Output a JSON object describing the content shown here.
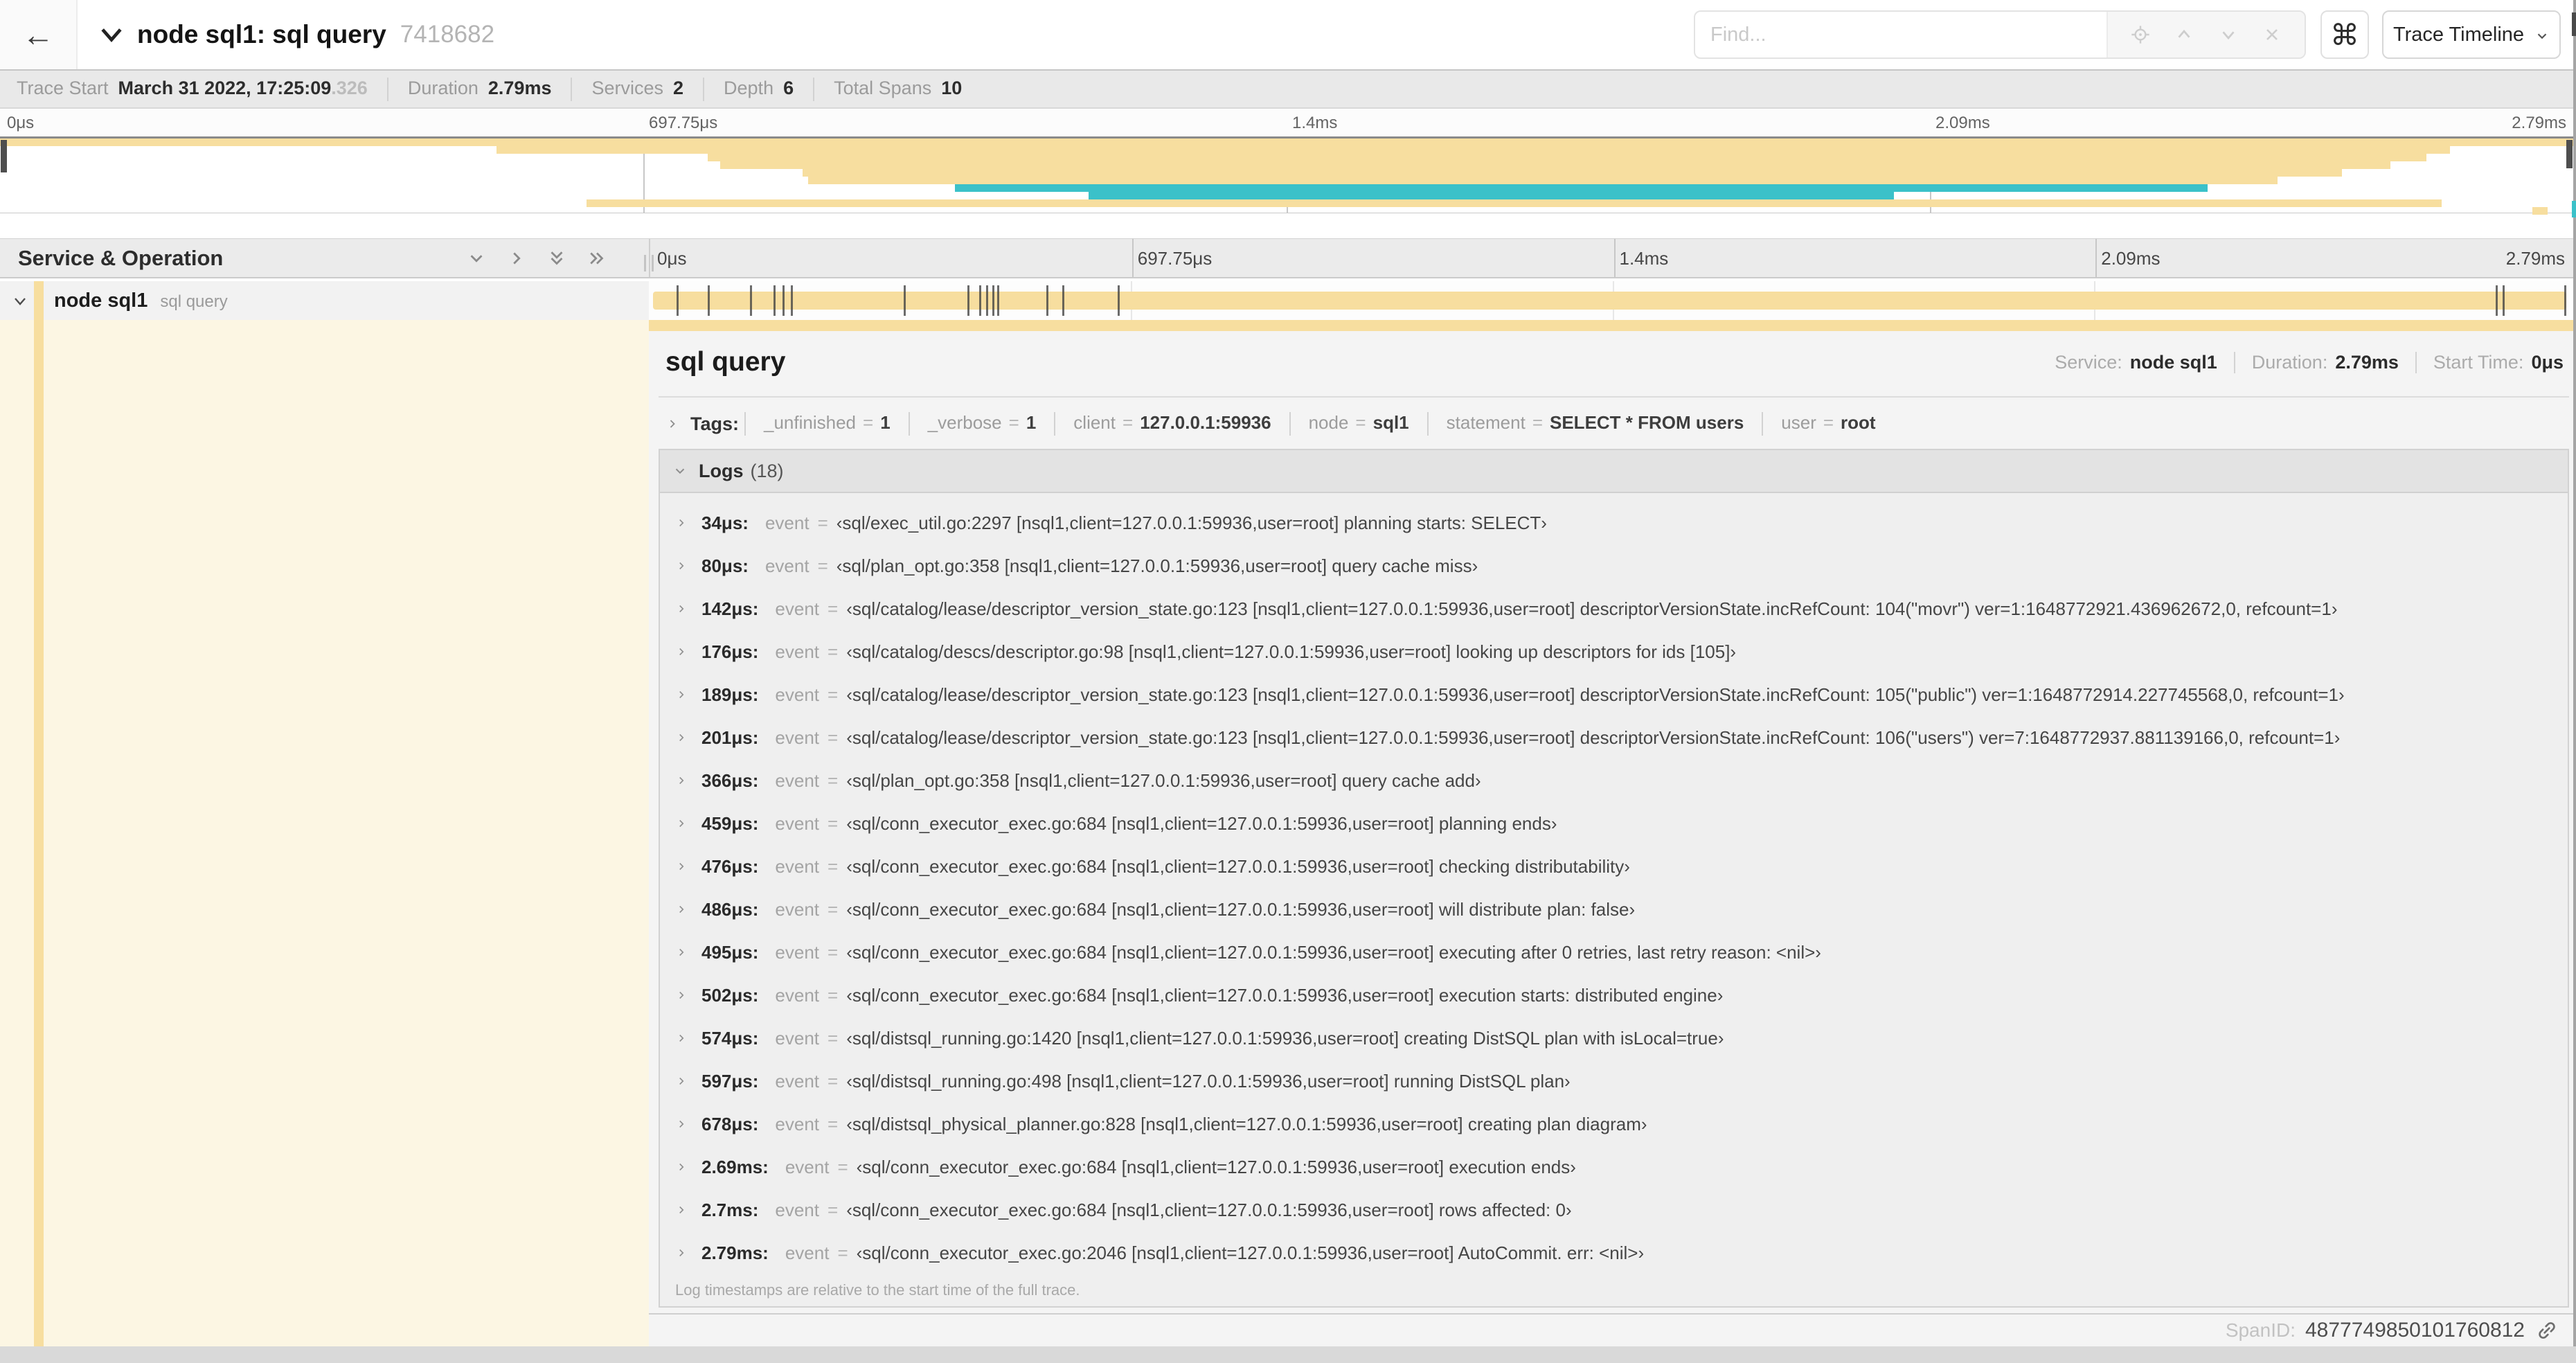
{
  "colors": {
    "tan": "#F7DE9F",
    "teal": "#3BC1C9"
  },
  "trace": {
    "duration_us": 2790
  },
  "header": {
    "back_icon": "←",
    "title": "node sql1: sql query",
    "trace_id": "7418682",
    "find_placeholder": "Find...",
    "shortcuts_glyph": "⌘",
    "view_selector": "Trace Timeline"
  },
  "summary": {
    "items": [
      {
        "label": "Trace Start",
        "value": "March 31 2022, 17:25:09",
        "suffix": ".326"
      },
      {
        "label": "Duration",
        "value": "2.79ms"
      },
      {
        "label": "Services",
        "value": "2"
      },
      {
        "label": "Depth",
        "value": "6"
      },
      {
        "label": "Total Spans",
        "value": "10"
      }
    ]
  },
  "timeline": {
    "ticks": [
      "0μs",
      "697.75μs",
      "1.4ms",
      "2.09ms",
      "2.79ms"
    ]
  },
  "minimap": {
    "spans": [
      {
        "start": 0,
        "end": 100,
        "color": "tan"
      },
      {
        "start": 19.3,
        "end": 95.2,
        "color": "tan"
      },
      {
        "start": 27.5,
        "end": 94.3,
        "color": "tan"
      },
      {
        "start": 28.0,
        "end": 92.9,
        "color": "tan"
      },
      {
        "start": 31.2,
        "end": 91.0,
        "color": "tan"
      },
      {
        "start": 31.4,
        "end": 88.5,
        "color": "tan"
      },
      {
        "start": 37.1,
        "end": 85.8,
        "color": "teal"
      },
      {
        "start": 42.3,
        "end": 73.6,
        "color": "teal"
      },
      {
        "start": 22.8,
        "end": 94.9,
        "color": "tan"
      },
      {
        "start": 98.4,
        "end": 99.0,
        "color": "tan"
      }
    ]
  },
  "tree": {
    "header": "Service & Operation",
    "service": "node sql1",
    "operation": "sql query"
  },
  "detail": {
    "title": "sql query",
    "meta": [
      {
        "label": "Service:",
        "value": "node sql1"
      },
      {
        "label": "Duration:",
        "value": "2.79ms"
      },
      {
        "label": "Start Time:",
        "value": "0μs"
      }
    ],
    "tags": {
      "label": "Tags:",
      "items": [
        {
          "key": "_unfinished",
          "value": "1"
        },
        {
          "key": "_verbose",
          "value": "1"
        },
        {
          "key": "client",
          "value": "127.0.0.1:59936"
        },
        {
          "key": "node",
          "value": "sql1"
        },
        {
          "key": "statement",
          "value": "SELECT * FROM users"
        },
        {
          "key": "user",
          "value": "root"
        }
      ]
    },
    "logs": {
      "label": "Logs",
      "count": "(18)",
      "key": "event",
      "entries": [
        {
          "time": "34μs",
          "us": 34,
          "value": "‹sql/exec_util.go:2297 [nsql1,client=127.0.0.1:59936,user=root] planning starts: SELECT›"
        },
        {
          "time": "80μs",
          "us": 80,
          "value": "‹sql/plan_opt.go:358 [nsql1,client=127.0.0.1:59936,user=root] query cache miss›"
        },
        {
          "time": "142μs",
          "us": 142,
          "value": "‹sql/catalog/lease/descriptor_version_state.go:123 [nsql1,client=127.0.0.1:59936,user=root] descriptorVersionState.incRefCount: 104(\"movr\") ver=1:1648772921.436962672,0, refcount=1›"
        },
        {
          "time": "176μs",
          "us": 176,
          "value": "‹sql/catalog/descs/descriptor.go:98 [nsql1,client=127.0.0.1:59936,user=root] looking up descriptors for ids [105]›"
        },
        {
          "time": "189μs",
          "us": 189,
          "value": "‹sql/catalog/lease/descriptor_version_state.go:123 [nsql1,client=127.0.0.1:59936,user=root] descriptorVersionState.incRefCount: 105(\"public\") ver=1:1648772914.227745568,0, refcount=1›"
        },
        {
          "time": "201μs",
          "us": 201,
          "value": "‹sql/catalog/lease/descriptor_version_state.go:123 [nsql1,client=127.0.0.1:59936,user=root] descriptorVersionState.incRefCount: 106(\"users\") ver=7:1648772937.881139166,0, refcount=1›"
        },
        {
          "time": "366μs",
          "us": 366,
          "value": "‹sql/plan_opt.go:358 [nsql1,client=127.0.0.1:59936,user=root] query cache add›"
        },
        {
          "time": "459μs",
          "us": 459,
          "value": "‹sql/conn_executor_exec.go:684 [nsql1,client=127.0.0.1:59936,user=root] planning ends›"
        },
        {
          "time": "476μs",
          "us": 476,
          "value": "‹sql/conn_executor_exec.go:684 [nsql1,client=127.0.0.1:59936,user=root] checking distributability›"
        },
        {
          "time": "486μs",
          "us": 486,
          "value": "‹sql/conn_executor_exec.go:684 [nsql1,client=127.0.0.1:59936,user=root] will distribute plan: false›"
        },
        {
          "time": "495μs",
          "us": 495,
          "value": "‹sql/conn_executor_exec.go:684 [nsql1,client=127.0.0.1:59936,user=root] executing after 0 retries, last retry reason: <nil>›"
        },
        {
          "time": "502μs",
          "us": 502,
          "value": "‹sql/conn_executor_exec.go:684 [nsql1,client=127.0.0.1:59936,user=root] execution starts: distributed engine›"
        },
        {
          "time": "574μs",
          "us": 574,
          "value": "‹sql/distsql_running.go:1420 [nsql1,client=127.0.0.1:59936,user=root] creating DistSQL plan with isLocal=true›"
        },
        {
          "time": "597μs",
          "us": 597,
          "value": "‹sql/distsql_running.go:498 [nsql1,client=127.0.0.1:59936,user=root] running DistSQL plan›"
        },
        {
          "time": "678μs",
          "us": 678,
          "value": "‹sql/distsql_physical_planner.go:828 [nsql1,client=127.0.0.1:59936,user=root] creating plan diagram›"
        },
        {
          "time": "2.69ms",
          "us": 2690,
          "value": "‹sql/conn_executor_exec.go:684 [nsql1,client=127.0.0.1:59936,user=root] execution ends›"
        },
        {
          "time": "2.7ms",
          "us": 2700,
          "value": "‹sql/conn_executor_exec.go:684 [nsql1,client=127.0.0.1:59936,user=root] rows affected: 0›"
        },
        {
          "time": "2.79ms",
          "us": 2790,
          "value": "‹sql/conn_executor_exec.go:2046 [nsql1,client=127.0.0.1:59936,user=root] AutoCommit. err: <nil>›"
        }
      ],
      "footnote": "Log timestamps are relative to the start time of the full trace."
    },
    "span_id_label": "SpanID:",
    "span_id": "4877749850101760812"
  }
}
